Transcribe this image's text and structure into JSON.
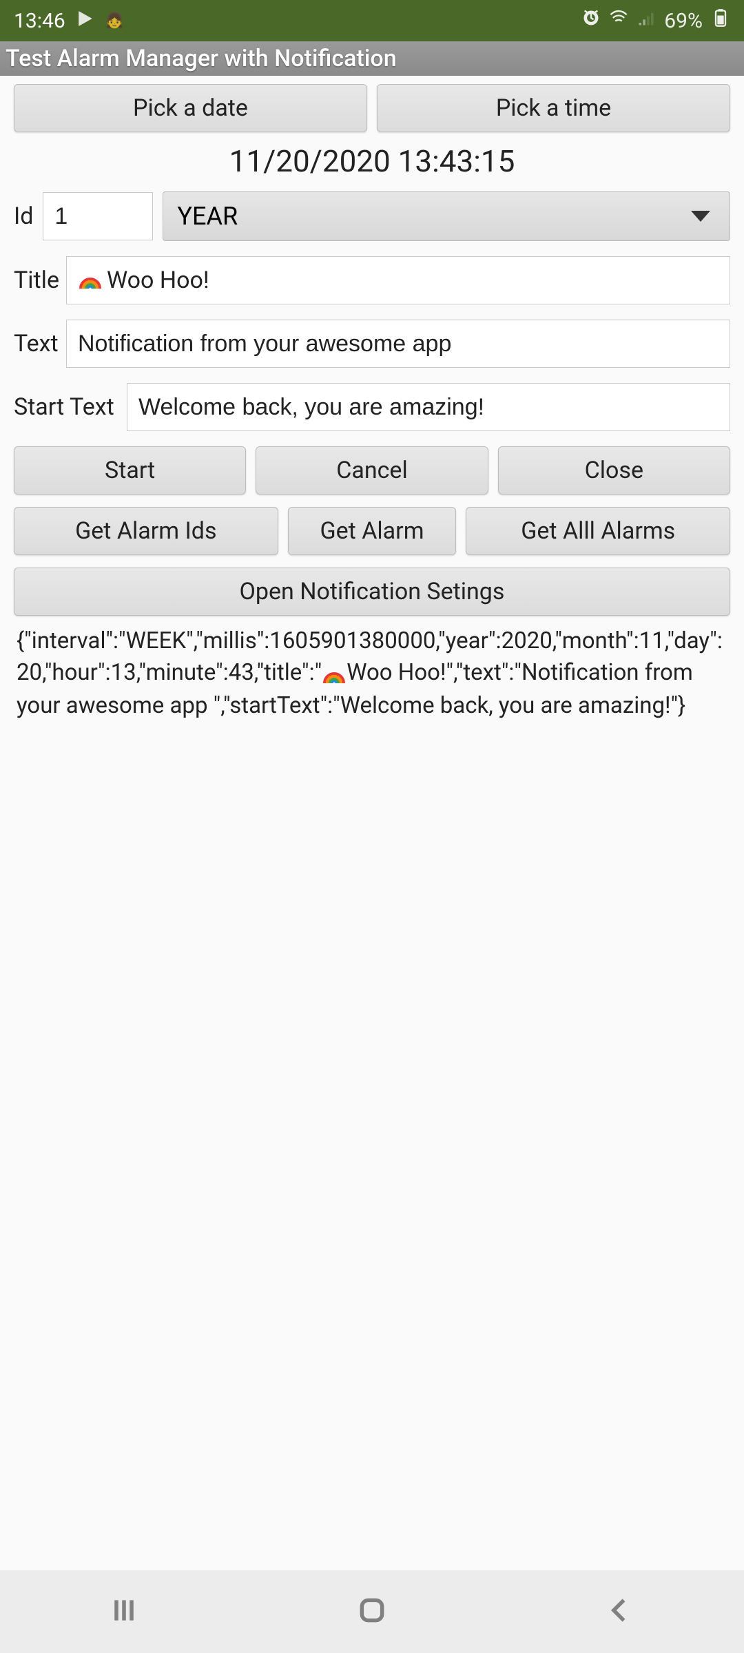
{
  "status": {
    "time": "13:46",
    "battery": "69%"
  },
  "appbar": {
    "title": "Test Alarm Manager with Notification"
  },
  "pickers": {
    "date_label": "Pick a date",
    "time_label": "Pick a time"
  },
  "datetime_display": "11/20/2020 13:43:15",
  "form": {
    "id_label": "Id",
    "id_value": "1",
    "interval_selected": "YEAR",
    "title_label": "Title",
    "title_value": "Woo Hoo!",
    "text_label": "Text",
    "text_value": "Notification from your awesome app",
    "starttext_label": "Start Text",
    "starttext_value": "Welcome back, you are amazing!"
  },
  "actions": {
    "start": "Start",
    "cancel": "Cancel",
    "close": "Close",
    "get_alarm_ids": "Get Alarm Ids",
    "get_alarm": "Get Alarm",
    "get_all_alarms": "Get Alll Alarms",
    "open_settings": "Open Notification Setings"
  },
  "output": {
    "pre": "{\"interval\":\"WEEK\",\"millis\":1605901380000,\"year\":2020,\"month\":11,\"day\":20,\"hour\":13,\"minute\":43,\"title\":\"",
    "mid": "Woo Hoo!\",\"text\":\"Notification from your awesome app \",\"startText\":\"Welcome back, you are amazing!\"}"
  }
}
